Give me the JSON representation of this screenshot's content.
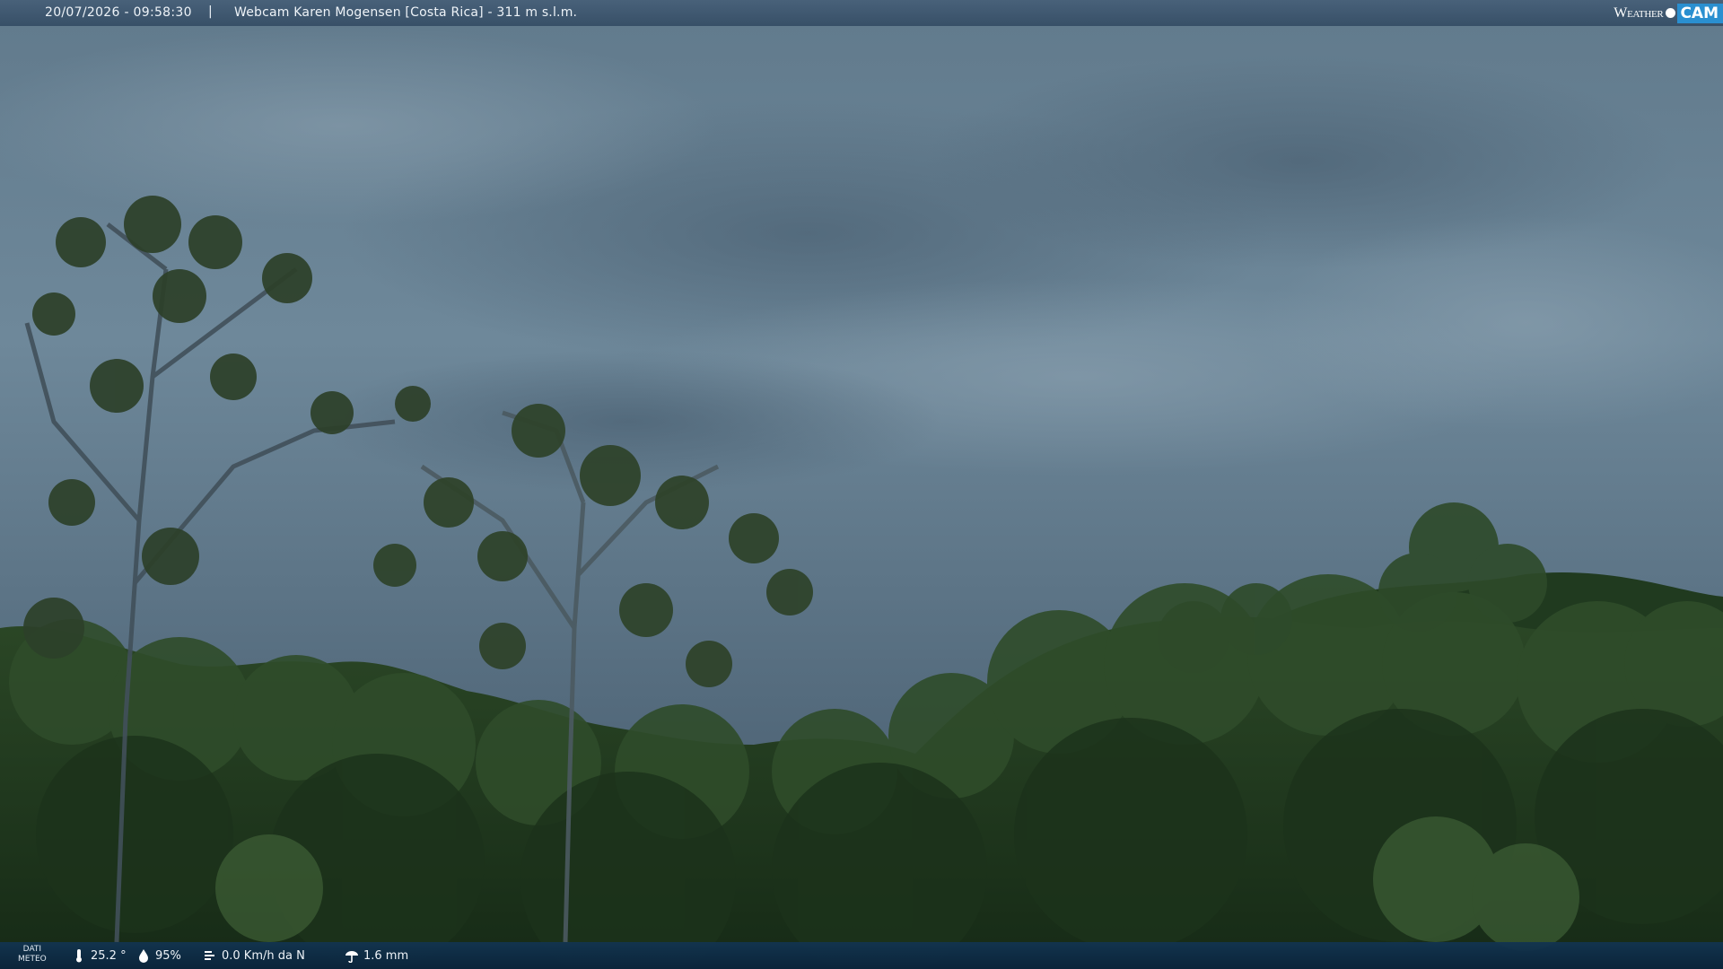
{
  "header": {
    "datetime": "20/07/2026 - 09:58:30",
    "separator": "|",
    "camera_title": "Webcam Karen Mogensen [Costa Rica]  - 311 m s.l.m."
  },
  "logo": {
    "word": "Weather",
    "cam": "CAM"
  },
  "footer": {
    "label_line1": "DATI",
    "label_line2": "METEO",
    "temperature": "25.2 °",
    "humidity": "95%",
    "wind": "0.0 Km/h da N",
    "rain": "1.6 mm"
  },
  "icons": [
    "thermometer-icon",
    "humidity-icon",
    "wind-icon",
    "rain-icon"
  ],
  "colors": {
    "sky": "#6f8799",
    "foliage": "#24401f",
    "bar": "#0e2b46",
    "logo_accent": "#2a8fd0"
  }
}
